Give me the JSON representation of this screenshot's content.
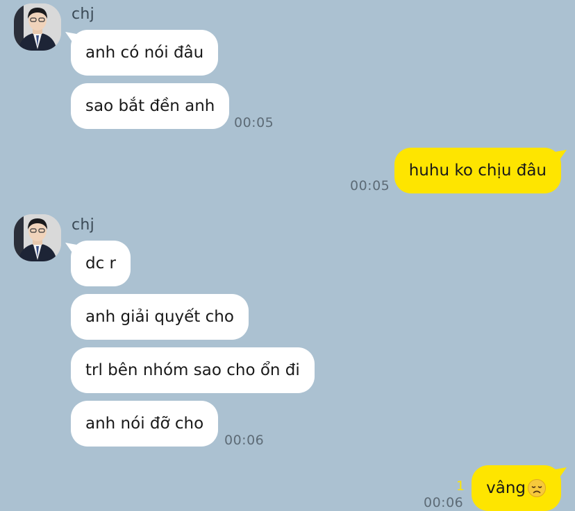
{
  "contact": {
    "name": "chj"
  },
  "messages": [
    {
      "text": "anh có nói đâu"
    },
    {
      "text": "sao bắt đền anh",
      "time": "00:05"
    },
    {
      "text": "huhu ko chịu đâu",
      "time": "00:05"
    },
    {
      "text": "dc r"
    },
    {
      "text": "anh giải quyết cho"
    },
    {
      "text": "trl bên nhóm sao cho ổn đi"
    },
    {
      "text": "anh nói đỡ cho",
      "time": "00:06"
    },
    {
      "text": "vâng",
      "time": "00:06",
      "unread": "1",
      "emoji": "disappointed-face-emoji"
    }
  ],
  "colors": {
    "background": "#abc1d1",
    "incoming_bubble": "#ffffff",
    "outgoing_bubble": "#fee500",
    "unread_count": "#fee500"
  }
}
